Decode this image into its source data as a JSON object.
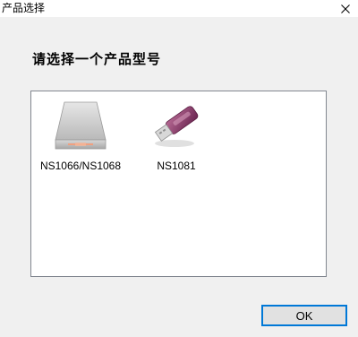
{
  "window": {
    "title": "产品选择",
    "close_icon": "close-icon",
    "close_glyph": "✕"
  },
  "prompt": "请选择一个产品型号",
  "products": [
    {
      "label": "NS1066/NS1068",
      "icon": "hard-drive-enclosure-icon"
    },
    {
      "label": "NS1081",
      "icon": "usb-drive-icon"
    }
  ],
  "buttons": {
    "ok_label": "OK"
  },
  "colors": {
    "dialog_background": "#f0f0f0",
    "focus_border": "#0078d7",
    "usb_body": "#8a3a6a"
  }
}
